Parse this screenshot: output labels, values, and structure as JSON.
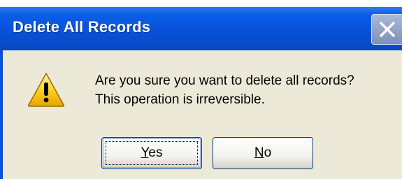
{
  "window": {
    "title": "Delete All Records",
    "close_icon": "close-icon",
    "colors": {
      "titlebar": "#0752d8",
      "client_background": "#ece9d8",
      "close_button": "#8d9fc4",
      "button_border": "#003c74"
    }
  },
  "message": {
    "icon": "warning-icon",
    "line1": "Are you sure you want to delete all records?",
    "line2": "This operation is irreversible."
  },
  "buttons": {
    "yes": {
      "accelerator": "Y",
      "rest": "es"
    },
    "no": {
      "accelerator": "N",
      "rest": "o"
    }
  }
}
